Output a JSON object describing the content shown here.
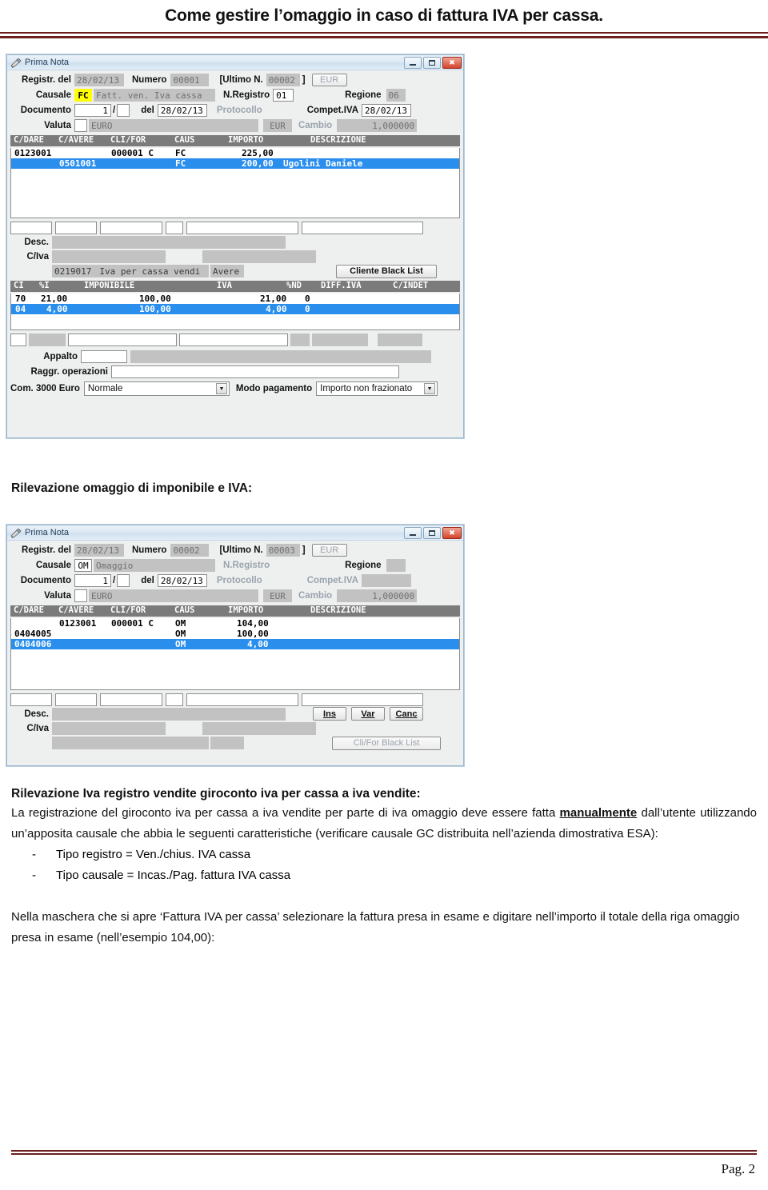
{
  "document": {
    "title": "Come gestire l’omaggio in caso di fattura IVA per cassa.",
    "page_label": "Pag. 2",
    "accent_color": "#6d1f1f"
  },
  "section_heading": "Rilevazione omaggio di imponibile e IVA:",
  "window1": {
    "title": "Prima Nota",
    "icon": "pencil-note-icon",
    "buttons": {
      "minimize": "minimize-icon",
      "maximize": "maximize-icon",
      "close": "close-icon"
    },
    "fields": {
      "registr_del_label": "Registr. del",
      "registr_del_value": "28/02/13",
      "numero_label": "Numero",
      "numero_value": "00001",
      "ultimo_n_label": "[Ultimo N.",
      "ultimo_n_value": "00002",
      "ultimo_n_close": "]",
      "eur_button": "EUR",
      "causale_label": "Causale",
      "causale_code": "FC",
      "causale_desc": "Fatt. ven. Iva cassa",
      "n_registro_label": "N.Registro",
      "n_registro_value": "01",
      "regione_label": "Regione",
      "regione_value": "06",
      "documento_label": "Documento",
      "documento_num": "1",
      "documento_sep": "/",
      "documento_sub": "",
      "del_label": "del",
      "del_value": "28/02/13",
      "protocollo_label": "Protocollo",
      "protocollo_value": "",
      "compet_iva_label": "Compet.IVA",
      "compet_iva_value": "28/02/13",
      "valuta_label": "Valuta",
      "valuta_code": "",
      "valuta_desc": "EURO",
      "eur_box": "EUR",
      "cambio_label": "Cambio",
      "cambio_value": "1,000000"
    },
    "movement_grid": {
      "headers": [
        "C/DARE",
        "C/AVERE",
        "CLI/FOR",
        "CAUS",
        "IMPORTO",
        "DESCRIZIONE"
      ],
      "rows": [
        {
          "cdare": "0123001",
          "cavere": "",
          "clifor": "000001 C",
          "caus": "FC",
          "importo": "225,00",
          "descrizione": "",
          "selected": false
        },
        {
          "cdare": "",
          "cavere": "0501001",
          "clifor": "",
          "caus": "FC",
          "importo": "200,00",
          "descrizione": "Ugolini Daniele",
          "selected": true
        }
      ]
    },
    "detail": {
      "desc_label": "Desc.",
      "desc_value": "",
      "civa_label": "C/Iva",
      "civa_value_1": "",
      "civa_value_2": "",
      "conto_code": "0219017",
      "conto_desc": "Iva per cassa vendi",
      "conto_segno": "Avere",
      "black_list_button": "Cliente Black List"
    },
    "iva_grid": {
      "headers": [
        "CI",
        "%I",
        "IMPONIBILE",
        "IVA",
        "%ND",
        "DIFF.IVA",
        "C/INDET"
      ],
      "rows": [
        {
          "ci": "70",
          "pi": "21,00",
          "imponibile": "100,00",
          "iva": "21,00",
          "pnd": "0",
          "diff_iva": "",
          "cindet": "",
          "selected": false
        },
        {
          "ci": "04",
          "pi": "4,00",
          "imponibile": "100,00",
          "iva": "4,00",
          "pnd": "0",
          "diff_iva": "",
          "cindet": "",
          "selected": true
        }
      ]
    },
    "footer": {
      "appalto_label": "Appalto",
      "appalto_value": "",
      "appalto_desc": "",
      "raggr_label": "Raggr. operazioni",
      "raggr_value": "",
      "com3000_label": "Com. 3000 Euro",
      "com3000_value": "Normale",
      "modo_pagamento_label": "Modo pagamento",
      "modo_pagamento_value": "Importo non frazionato"
    }
  },
  "window2": {
    "title": "Prima Nota",
    "icon": "pencil-note-icon",
    "buttons": {
      "minimize": "minimize-icon",
      "maximize": "maximize-icon",
      "close": "close-icon"
    },
    "fields": {
      "registr_del_label": "Registr. del",
      "registr_del_value": "28/02/13",
      "numero_label": "Numero",
      "numero_value": "00002",
      "ultimo_n_label": "[Ultimo N.",
      "ultimo_n_value": "00003",
      "ultimo_n_close": "]",
      "eur_button": "EUR",
      "causale_label": "Causale",
      "causale_code": "OM",
      "causale_desc": "Omaggio",
      "n_registro_label": "N.Registro",
      "n_registro_value": "",
      "regione_label": "Regione",
      "regione_value": "",
      "documento_label": "Documento",
      "documento_num": "1",
      "documento_sep": "/",
      "documento_sub": "",
      "del_label": "del",
      "del_value": "28/02/13",
      "protocollo_label": "Protocollo",
      "protocollo_value": "",
      "compet_iva_label": "Compet.IVA",
      "compet_iva_value": "",
      "valuta_label": "Valuta",
      "valuta_code": "",
      "valuta_desc": "EURO",
      "eur_box": "EUR",
      "cambio_label": "Cambio",
      "cambio_value": "1,000000"
    },
    "movement_grid": {
      "headers": [
        "C/DARE",
        "C/AVERE",
        "CLI/FOR",
        "CAUS",
        "IMPORTO",
        "DESCRIZIONE"
      ],
      "rows": [
        {
          "cdare": "",
          "cavere": "0123001",
          "clifor": "000001 C",
          "caus": "OM",
          "importo": "104,00",
          "descrizione": "",
          "selected": false
        },
        {
          "cdare": "0404005",
          "cavere": "",
          "clifor": "",
          "caus": "OM",
          "importo": "100,00",
          "descrizione": "",
          "selected": false
        },
        {
          "cdare": "0404006",
          "cavere": "",
          "clifor": "",
          "caus": "OM",
          "importo": "4,00",
          "descrizione": "",
          "selected": true
        }
      ]
    },
    "detail": {
      "desc_label": "Desc.",
      "desc_value": "",
      "civa_label": "C/Iva",
      "civa_value_1": "",
      "civa_value_2": "",
      "ins_button": "Ins",
      "var_button": "Var",
      "canc_button": "Canc",
      "black_list_button": "Cli/For Black List"
    }
  },
  "text": {
    "heading2": "Rilevazione Iva registro vendite giroconto iva per cassa a iva vendite:",
    "para1_a": "La registrazione del giroconto iva per cassa a iva vendite per parte di iva omaggio deve essere fatta ",
    "para1_bold": "manualmente",
    "para1_b": " dall’utente utilizzando un’apposita causale che abbia le seguenti caratteristiche (verificare causale GC distribuita nell’azienda dimostrativa ESA):",
    "bullets": [
      "Tipo registro = Ven./chius. IVA cassa",
      "Tipo causale = Incas./Pag. fattura IVA cassa"
    ],
    "para2": "Nella maschera che si apre ‘Fattura IVA per cassa’ selezionare la fattura presa in esame e digitare nell’importo il totale della riga omaggio presa in esame (nell’esempio 104,00):"
  }
}
